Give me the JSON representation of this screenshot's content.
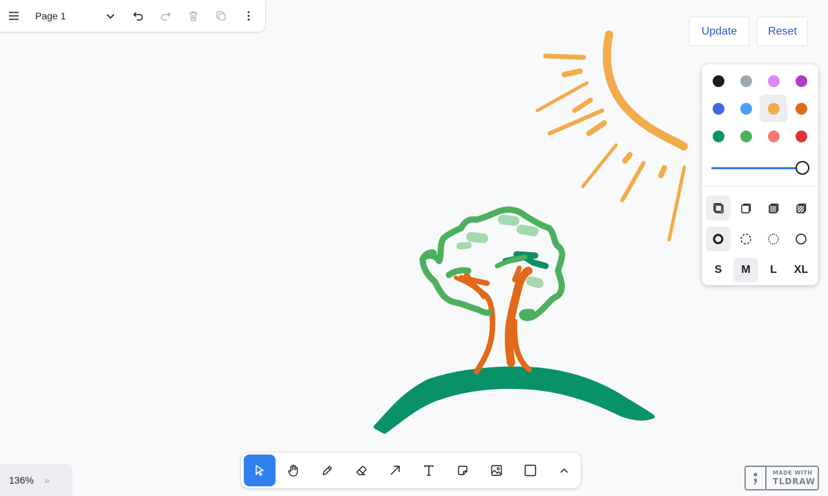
{
  "menu": {
    "page_name": "Page 1",
    "icons": [
      "hamburger-menu-icon",
      "chevron-down-icon",
      "undo-icon",
      "redo-icon",
      "trash-icon",
      "duplicate-icon",
      "more-vertical-icon"
    ]
  },
  "top_buttons": {
    "update": "Update",
    "reset": "Reset"
  },
  "style_panel": {
    "colors": [
      {
        "name": "black",
        "hex": "#1d1d1d",
        "selected": false
      },
      {
        "name": "grey",
        "hex": "#9fa8b2",
        "selected": false
      },
      {
        "name": "light-violet",
        "hex": "#e085f4",
        "selected": false
      },
      {
        "name": "violet",
        "hex": "#ae3ec9",
        "selected": false
      },
      {
        "name": "blue",
        "hex": "#4465e9",
        "selected": false
      },
      {
        "name": "light-blue",
        "hex": "#4ba1f1",
        "selected": false
      },
      {
        "name": "yellow",
        "hex": "#f1ac4b",
        "selected": true
      },
      {
        "name": "orange",
        "hex": "#e16919",
        "selected": false
      },
      {
        "name": "green",
        "hex": "#099268",
        "selected": false
      },
      {
        "name": "light-green",
        "hex": "#4cb05e",
        "selected": false
      },
      {
        "name": "light-red",
        "hex": "#f87777",
        "selected": false
      },
      {
        "name": "red",
        "hex": "#e03131",
        "selected": false
      }
    ],
    "opacity": 1.0,
    "fill_styles": [
      "fill-none-icon",
      "fill-semi-icon",
      "fill-solid-icon",
      "fill-pattern-icon"
    ],
    "fill_selected": 0,
    "dash_styles": [
      "dash-draw-icon",
      "dash-dashed-icon",
      "dash-dotted-icon",
      "dash-solid-icon"
    ],
    "dash_selected": 0,
    "sizes": [
      "S",
      "M",
      "L",
      "XL"
    ],
    "size_selected": 1
  },
  "toolbar": {
    "tools": [
      "select-icon",
      "hand-icon",
      "draw-icon",
      "eraser-icon",
      "arrow-icon",
      "text-icon",
      "note-icon",
      "image-icon",
      "rectangle-icon",
      "chevron-up-icon"
    ],
    "active": 0
  },
  "zoom": {
    "label": "136%",
    "chevrons": "»"
  },
  "watermark": {
    "line1": "MADE WITH",
    "line2": "TLDRAW"
  },
  "canvas_colors": {
    "sun": "#f2ac4b",
    "leaves": "#4cb05e",
    "leaves_light": "#a6d8ae",
    "leaves_dark": "#0d8f62",
    "trunk": "#e16919",
    "hill": "#099268"
  }
}
